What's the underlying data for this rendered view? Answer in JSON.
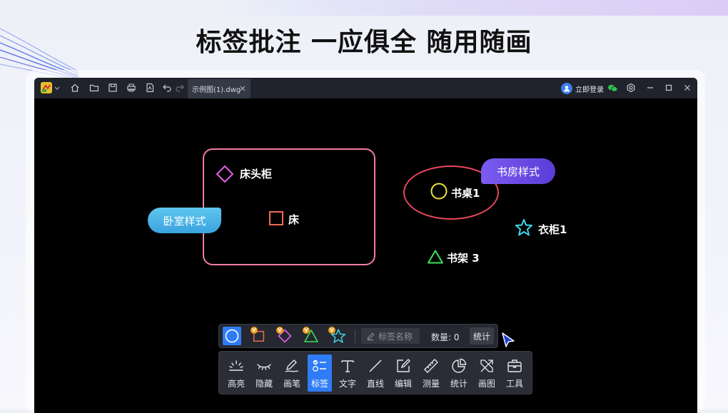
{
  "headline": "标签批注 一应俱全 随用随画",
  "window": {
    "tab": {
      "title": "示例图(1).dwg"
    },
    "login_label": "立即登录",
    "titlebar_icons": [
      "app-logo-icon",
      "home-icon",
      "folder-icon",
      "save-icon",
      "print-icon",
      "pdf-icon",
      "undo-icon",
      "redo-icon"
    ],
    "window_controls": [
      "wechat-icon",
      "settings-icon",
      "minimize-icon",
      "maximize-icon",
      "close-icon"
    ]
  },
  "canvas": {
    "tags": [
      {
        "label": "床头柜",
        "shape": "diamond",
        "color": "#e05ee6"
      },
      {
        "label": "床",
        "shape": "square",
        "color": "#f06a55"
      },
      {
        "label": "书桌1",
        "shape": "circle",
        "color": "#f0e040"
      },
      {
        "label": "衣柜1",
        "shape": "star",
        "color": "#3ed4e8"
      },
      {
        "label": "书架 3",
        "shape": "triangle",
        "color": "#3ee05a"
      }
    ],
    "styles": [
      {
        "label": "卧室样式",
        "color": "#4fb6ea"
      },
      {
        "label": "书房样式",
        "color": "#6a4ae4"
      }
    ],
    "room_outline_color": "#f27ca6",
    "study_outline_color": "#e8465c"
  },
  "tagbar": {
    "shapes": [
      {
        "shape": "circle",
        "active": true
      },
      {
        "shape": "square",
        "badge": "V"
      },
      {
        "shape": "diamond",
        "badge": "V"
      },
      {
        "shape": "triangle",
        "badge": "V"
      },
      {
        "shape": "star",
        "badge": "V"
      }
    ],
    "name_placeholder": "标签名称",
    "count_label": "数量: 0",
    "stat_button": "统计"
  },
  "toolbar": {
    "items": [
      {
        "label": "高亮",
        "icon": "highlight-icon"
      },
      {
        "label": "隐藏",
        "icon": "hide-icon"
      },
      {
        "label": "画笔",
        "icon": "pen-icon"
      },
      {
        "label": "标签",
        "icon": "tag-icon",
        "active": true
      },
      {
        "label": "文字",
        "icon": "text-icon"
      },
      {
        "label": "直线",
        "icon": "line-icon"
      },
      {
        "label": "编辑",
        "icon": "edit-icon"
      },
      {
        "label": "测量",
        "icon": "ruler-icon"
      },
      {
        "label": "统计",
        "icon": "pie-chart-icon"
      },
      {
        "label": "画图",
        "icon": "draw-icon"
      },
      {
        "label": "工具",
        "icon": "toolbox-icon"
      }
    ]
  },
  "colors": {
    "accent": "#2f7cf6",
    "badge": "#f0a020"
  }
}
